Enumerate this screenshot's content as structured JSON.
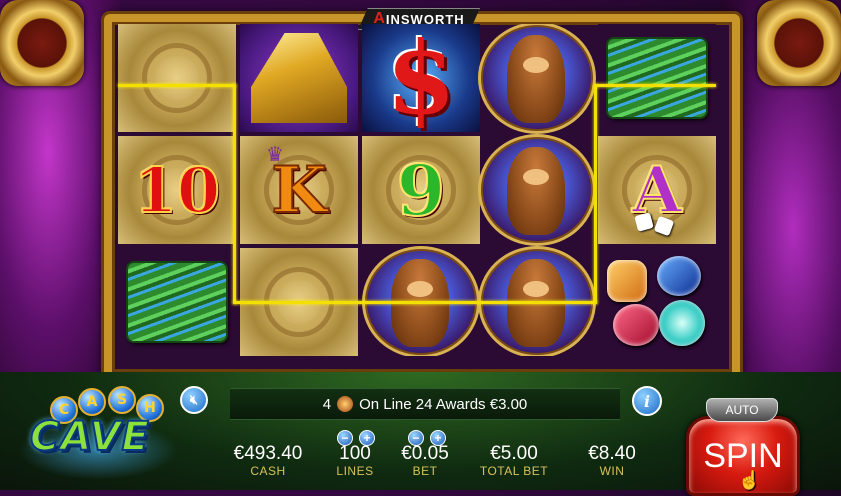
{
  "game": {
    "brand": "AINSWORTH",
    "brand_initial": "A",
    "brand_rest": "INSWORTH",
    "logo_word_1": [
      "C",
      "A",
      "S",
      "H"
    ],
    "logo_word_2": "CAVE"
  },
  "reels": [
    {
      "symbols": [
        "blank-tile-icon",
        "10",
        "money-stack-icon"
      ]
    },
    {
      "symbols": [
        "gold-bars-icon",
        "K",
        "blank-tile-icon"
      ]
    },
    {
      "symbols": [
        "$",
        "9",
        "bear-icon"
      ]
    },
    {
      "symbols": [
        "bear-icon",
        "bear-icon",
        "bear-icon"
      ]
    },
    {
      "symbols": [
        "money-stack-icon",
        "A",
        "gems-icon"
      ]
    }
  ],
  "symbol_text": {
    "ten": "10",
    "king": "K",
    "nine": "9",
    "ace": "A",
    "dollar": "$"
  },
  "message": {
    "count": "4",
    "icon": "bear-scatter-icon",
    "text": "On Line 24 Awards €3.00"
  },
  "stats": {
    "cash": {
      "value": "€493.40",
      "label": "CASH"
    },
    "lines": {
      "value": "100",
      "label": "LINES"
    },
    "bet": {
      "value": "€0.05",
      "label": "BET"
    },
    "total_bet": {
      "value": "€5.00",
      "label": "TOTAL BET"
    },
    "win": {
      "value": "€8.40",
      "label": "WIN"
    }
  },
  "buttons": {
    "minus": "−",
    "plus": "+",
    "auto": "AUTO",
    "spin": "SPIN",
    "info": "i",
    "mute_icon": "speaker-muted-icon"
  },
  "colors": {
    "payline": "#f4e000",
    "frame_gold": "#c8952a",
    "label_gold": "#d8c25a",
    "spin_red": "#d81a10"
  }
}
